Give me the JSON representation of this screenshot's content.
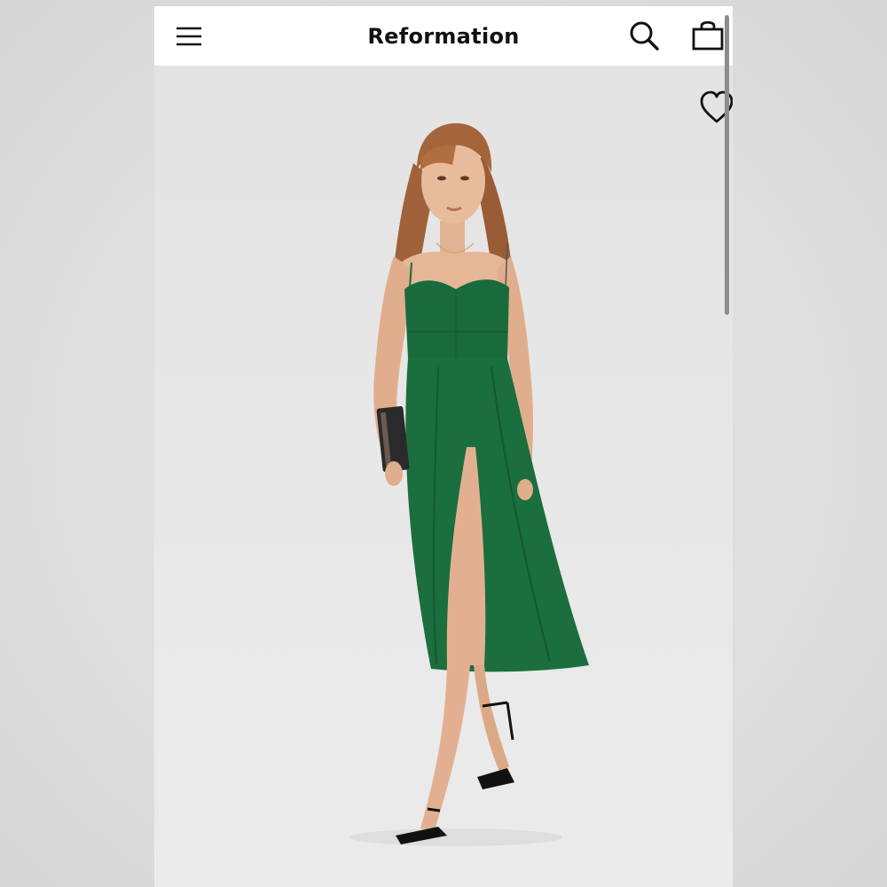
{
  "header": {
    "logo": "Reformation",
    "menu_icon": "hamburger-menu-icon",
    "search_icon": "search-icon",
    "bag_icon": "shopping-bag-icon"
  },
  "product": {
    "wishlist_icon": "heart-outline-icon",
    "dress_color": "#1a6b3c"
  },
  "colors": {
    "header_background": "#ffffff",
    "image_background": "#e7e7e7",
    "icon_color": "#111111"
  }
}
